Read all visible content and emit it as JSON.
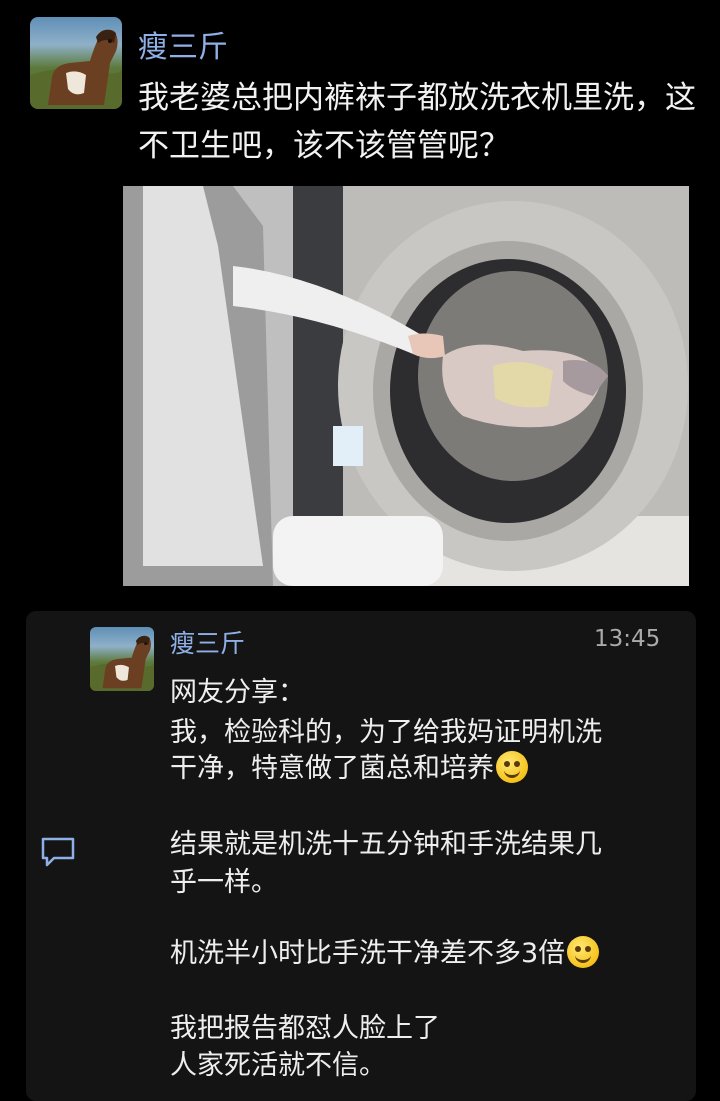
{
  "post": {
    "author": "瘦三斤",
    "text": "我老婆总把内裤袜子都放洗衣机里洗，这不卫生吧，该不该管管呢？"
  },
  "reply": {
    "author": "瘦三斤",
    "time": "13:45",
    "lines": [
      "网友分享：",
      "我，检验科的，为了给我妈证明机洗",
      "干净，特意做了菌总和培养",
      "结果就是机洗十五分钟和手洗结果几",
      "乎一样。",
      "机洗半小时比手洗干净差不多3倍",
      "我把报告都怼人脸上了",
      "人家死活就不信。"
    ]
  },
  "icons": {
    "comment": "comment-icon",
    "emoji": "smiling-face-emoji"
  },
  "colors": {
    "background": "#000000",
    "author_name": "#8fb0e6",
    "card": "#141414"
  }
}
